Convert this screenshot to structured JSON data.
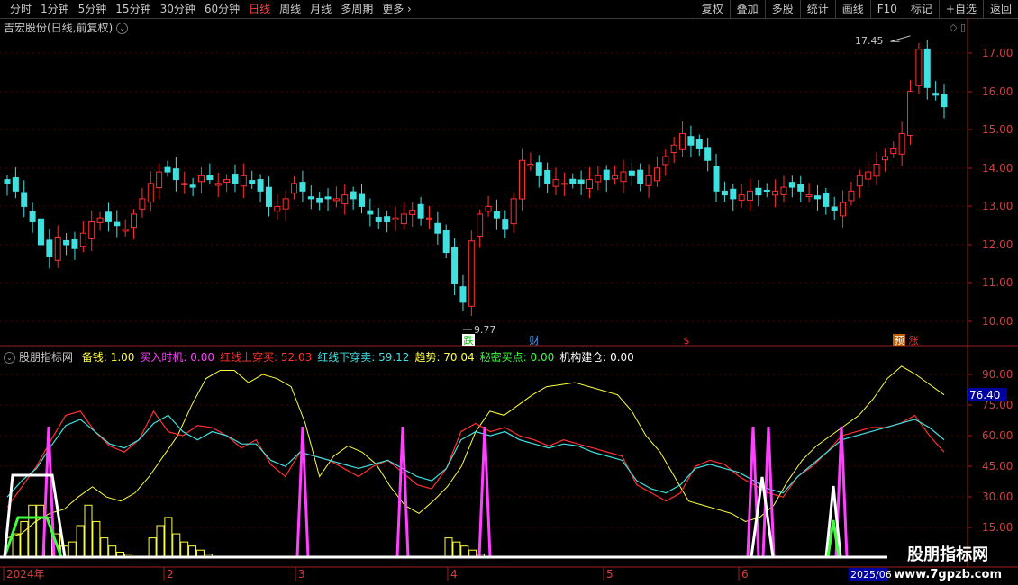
{
  "toolbar": {
    "periods": [
      "分时",
      "1分钟",
      "5分钟",
      "15分钟",
      "30分钟",
      "60分钟",
      "日线",
      "周线",
      "月线",
      "多周期",
      "更多"
    ],
    "active_period": "日线",
    "more_arrow": "›",
    "tools": [
      "复权",
      "叠加",
      "多股",
      "统计",
      "画线",
      "F10",
      "标记",
      "+自选",
      "返回"
    ]
  },
  "main_chart": {
    "title": "吉宏股份(日线,前复权)",
    "price_axis": [
      "17.00",
      "16.00",
      "15.00",
      "14.00",
      "13.00",
      "12.00",
      "11.00",
      "10.00"
    ],
    "high_label": "17.45",
    "low_label": "9.77",
    "markers": [
      {
        "text": "跌",
        "color": "#00c000",
        "bg": "#ffffff"
      },
      {
        "text": "财",
        "color": "#4fa0ff",
        "bg": ""
      },
      {
        "text": "$",
        "color": "#ff3030",
        "bg": ""
      },
      {
        "text": "预",
        "color": "#ffffff",
        "bg": "#c06000"
      },
      {
        "text": "涨",
        "color": "#ff3030",
        "bg": ""
      }
    ]
  },
  "indicator": {
    "name": "股朋指标网",
    "fields": [
      {
        "label": "备钱: 1.00",
        "color": "#ffff40"
      },
      {
        "label": "买入时机: 0.00",
        "color": "#ff40ff"
      },
      {
        "label": "红线上穿买: 52.03",
        "color": "#ff3030"
      },
      {
        "label": "红线下穿卖: 59.12",
        "color": "#40e0e0"
      },
      {
        "label": "趋势: 70.04",
        "color": "#ffff40"
      },
      {
        "label": "秘密买点: 0.00",
        "color": "#40ff40"
      },
      {
        "label": "机构建仓: 0.00",
        "color": "#ffffff"
      }
    ],
    "axis": [
      "90.00",
      "75.00",
      "60.00",
      "45.00",
      "30.00",
      "15.00"
    ],
    "current_value": "76.40"
  },
  "time_axis": {
    "labels": [
      "2024年",
      "2",
      "3",
      "4",
      "5",
      "6"
    ],
    "current": "2025/06"
  },
  "watermark": {
    "line1": "股朋指标网",
    "line2": "www.7gpzb.com"
  },
  "colors": {
    "up": "#ff3030",
    "down": "#40e0e0",
    "grid": "#5a0000"
  }
}
